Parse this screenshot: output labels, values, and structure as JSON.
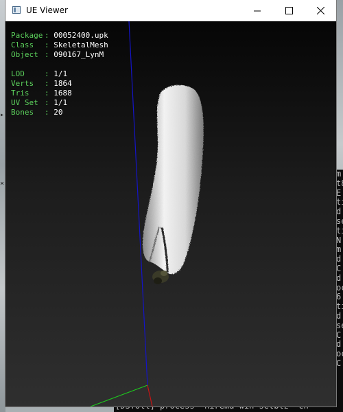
{
  "window": {
    "title": "UE Viewer"
  },
  "info_panel": {
    "group1": [
      {
        "label": "Package",
        "value": "00052400.upk"
      },
      {
        "label": "Class",
        "value": "SkeletalMesh"
      },
      {
        "label": "Object",
        "value": "090167_LynM"
      }
    ],
    "group2": [
      {
        "label": "LOD",
        "value": "1/1"
      },
      {
        "label": "Verts",
        "value": "1864"
      },
      {
        "label": "Tris",
        "value": "1688"
      },
      {
        "label": "UV Set",
        "value": "1/1"
      },
      {
        "label": "Bones",
        "value": "20"
      }
    ]
  },
  "console": {
    "right_lines": [
      "m",
      "t8",
      "E",
      "ti",
      "d",
      "se",
      "ti",
      "N",
      "m",
      "d",
      "C",
      "d",
      "oc",
      "6",
      "ti",
      "d",
      "se",
      "C",
      "d",
      "oc",
      "C"
    ],
    "bottom_line": "[DSToll] process  hirema win setblz  ch"
  },
  "colors": {
    "label_green": "#5dd35d",
    "value_white": "#ffffff",
    "axis_blue": "#1414c8",
    "axis_green": "#1ec81e",
    "axis_red": "#c81414"
  },
  "icons": {
    "app": "window-icon",
    "minimize": "minimize-icon",
    "maximize": "maximize-icon",
    "close": "close-icon"
  }
}
